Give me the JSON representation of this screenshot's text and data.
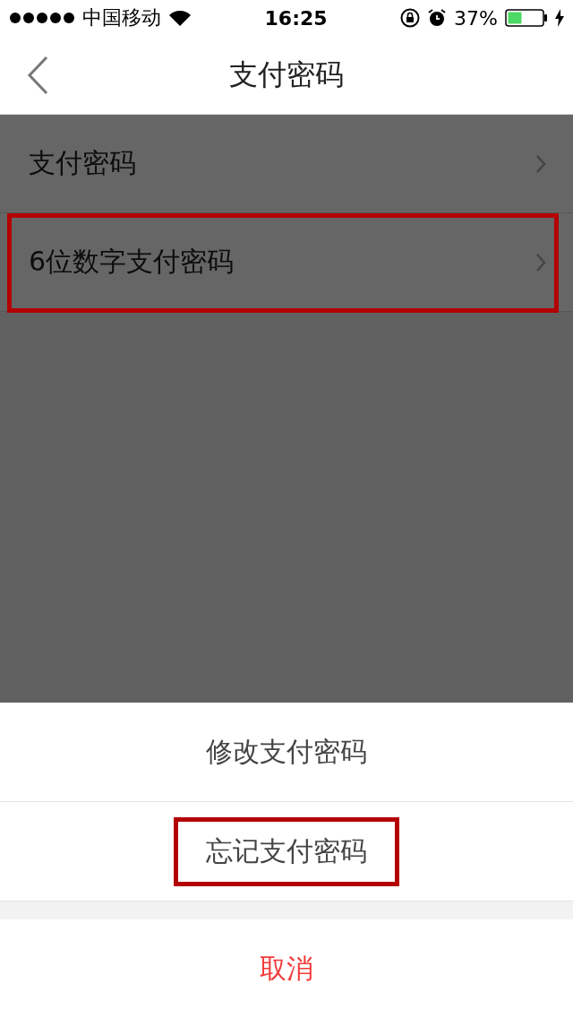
{
  "status_bar": {
    "carrier": "中国移动",
    "time": "16:25",
    "battery": "37%"
  },
  "nav": {
    "title": "支付密码"
  },
  "rows": [
    {
      "label": "支付密码",
      "highlighted": false
    },
    {
      "label": "6位数字支付密码",
      "highlighted": true
    }
  ],
  "overlay": {
    "dimmed": true
  },
  "action_sheet": {
    "options": [
      {
        "label": "修改支付密码",
        "highlighted": false
      },
      {
        "label": "忘记支付密码",
        "highlighted": true
      }
    ],
    "cancel": "取消"
  }
}
